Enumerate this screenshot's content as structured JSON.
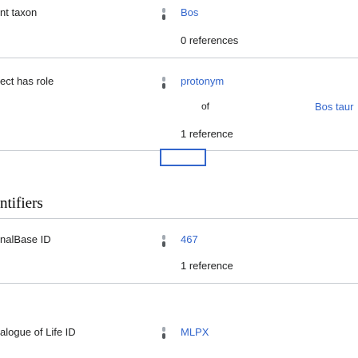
{
  "statements": [
    {
      "property": "nt taxon",
      "value": "Bos",
      "references": "0 references"
    },
    {
      "property": "ect has role",
      "value": "protonym",
      "qualifier": {
        "key": "of",
        "value": "Bos taur"
      },
      "references": "1 reference"
    }
  ],
  "section": {
    "title": "ntifiers"
  },
  "identifiers": [
    {
      "property": "nalBase ID",
      "value": "467",
      "references": "1 reference"
    },
    {
      "property": "alogue of Life ID",
      "value": "MLPX"
    }
  ],
  "colors": {
    "link": "#3366cc",
    "divider": "#c8ccd1",
    "focus": "#3366cc"
  }
}
